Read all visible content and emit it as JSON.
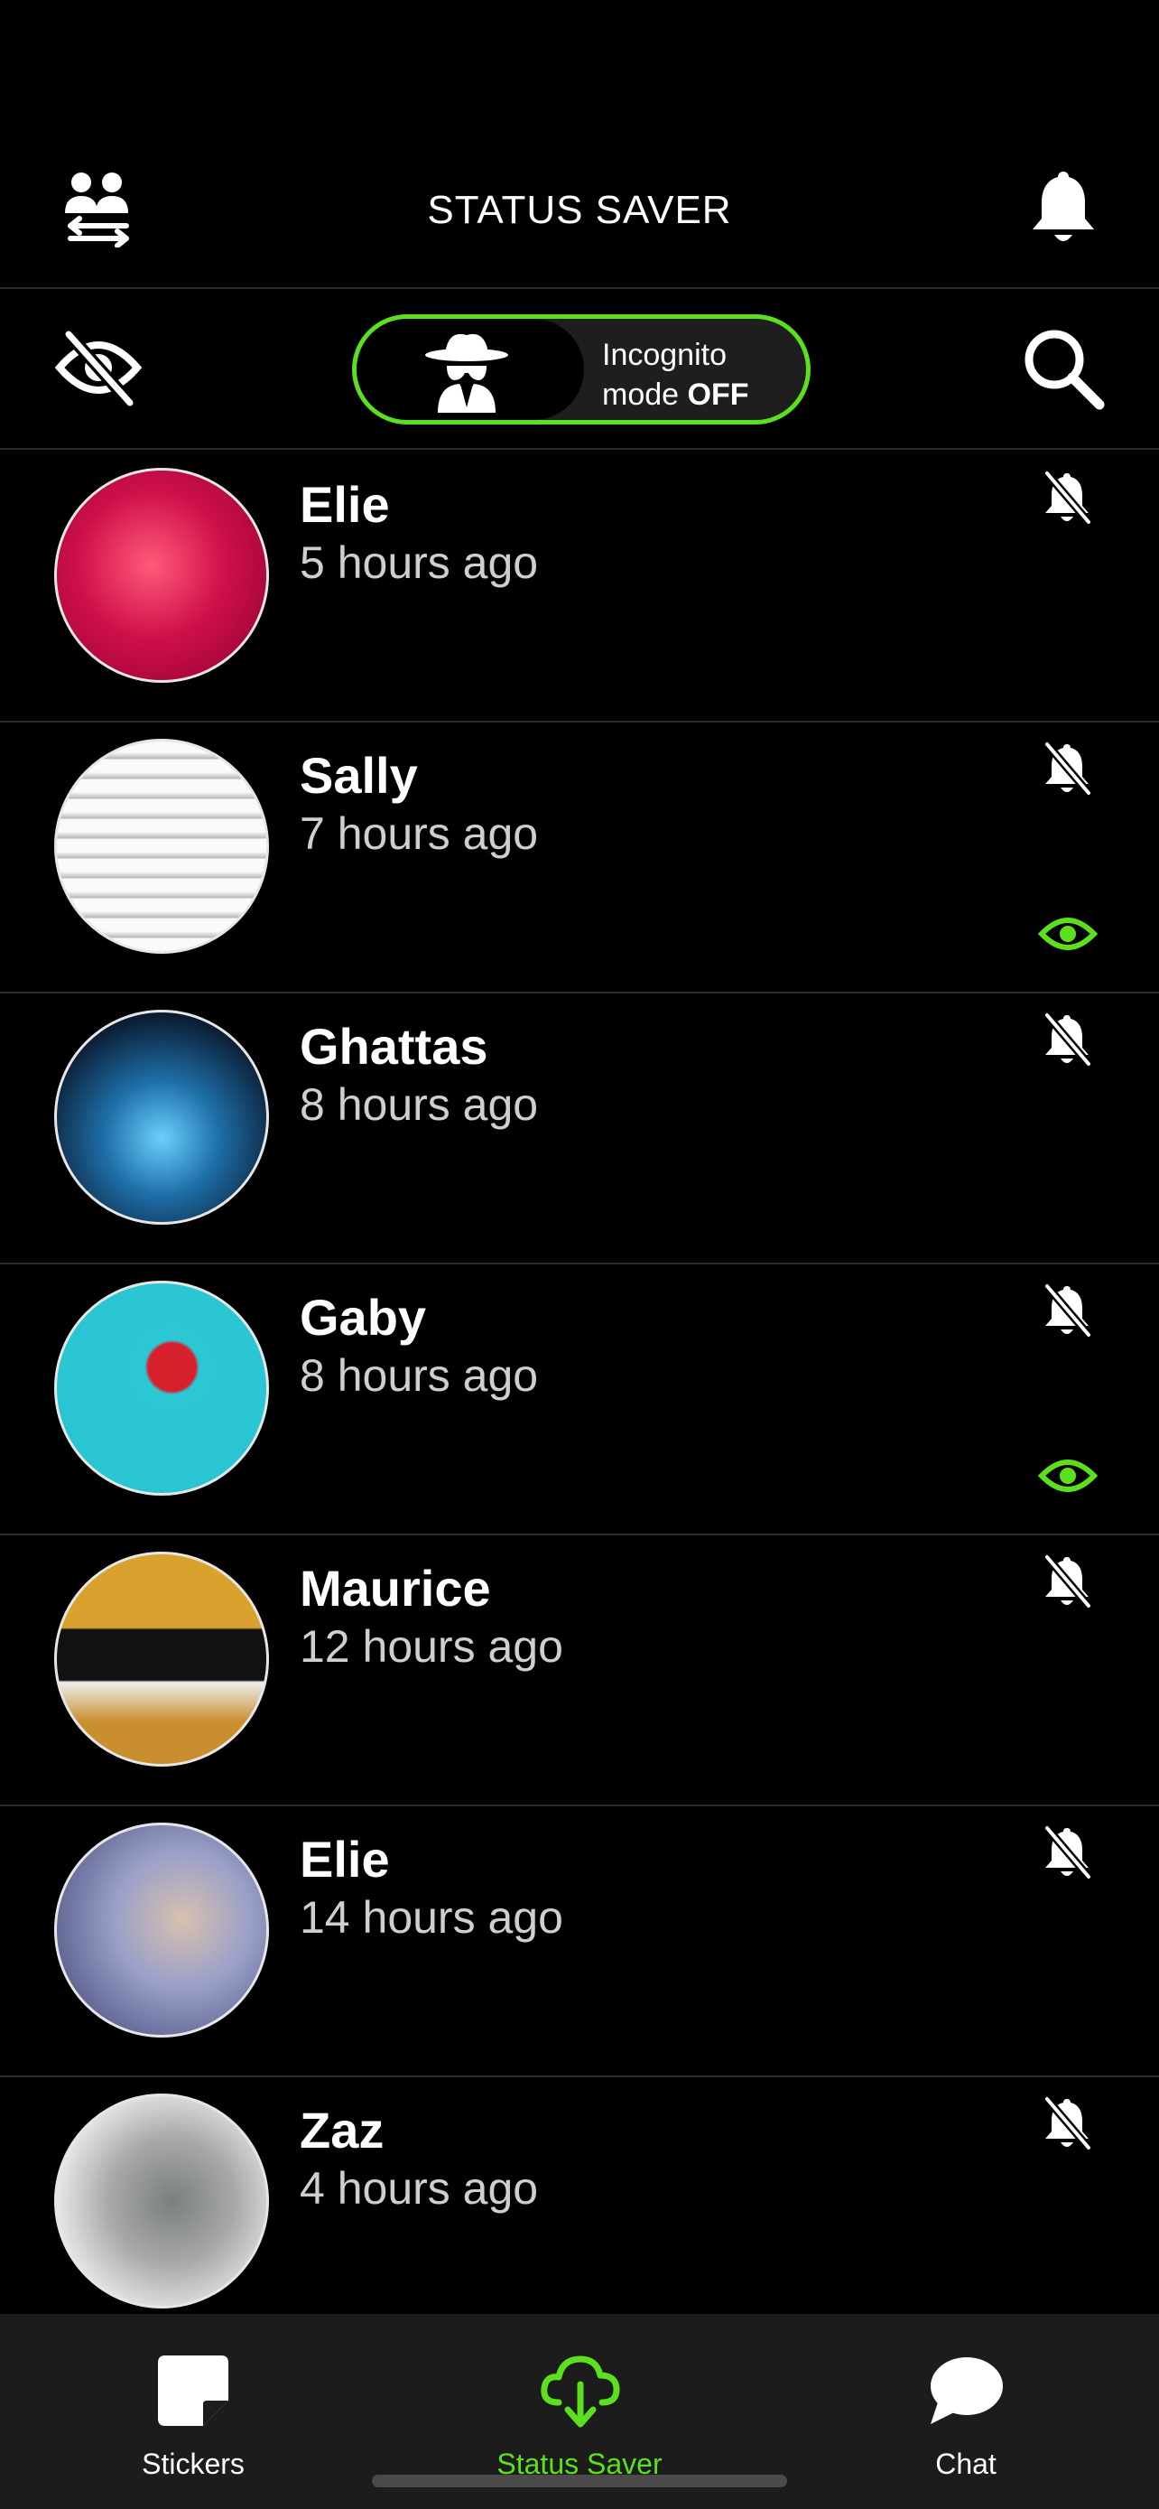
{
  "header": {
    "title": "STATUS SAVER",
    "left_icon": "swap-users-icon",
    "right_icon": "bell-icon"
  },
  "controls": {
    "hide_icon": "eye-slash-icon",
    "incognito_label_line1": "Incognito",
    "incognito_label_prefix": "mode",
    "incognito_state": "OFF",
    "incognito_icon": "spy-icon",
    "search_icon": "search-icon",
    "accent_color": "#5ce01e"
  },
  "statuses": [
    {
      "name": "Elie",
      "time": "5 hours ago",
      "viewed": false,
      "muted": true
    },
    {
      "name": "Sally",
      "time": "7 hours ago",
      "viewed": true,
      "muted": true
    },
    {
      "name": "Ghattas",
      "time": "8 hours ago",
      "viewed": false,
      "muted": true
    },
    {
      "name": "Gaby",
      "time": "8 hours ago",
      "viewed": true,
      "muted": true
    },
    {
      "name": "Maurice",
      "time": "12 hours ago",
      "viewed": false,
      "muted": true
    },
    {
      "name": "Elie",
      "time": "14 hours ago",
      "viewed": false,
      "muted": true
    },
    {
      "name": "Zaz",
      "time": "4 hours ago",
      "viewed": false,
      "muted": true
    }
  ],
  "tabs": [
    {
      "label": "Stickers",
      "icon": "sticker-icon",
      "active": false
    },
    {
      "label": "Status Saver",
      "icon": "cloud-download-icon",
      "active": true
    },
    {
      "label": "Chat",
      "icon": "chat-bubble-icon",
      "active": false
    }
  ]
}
